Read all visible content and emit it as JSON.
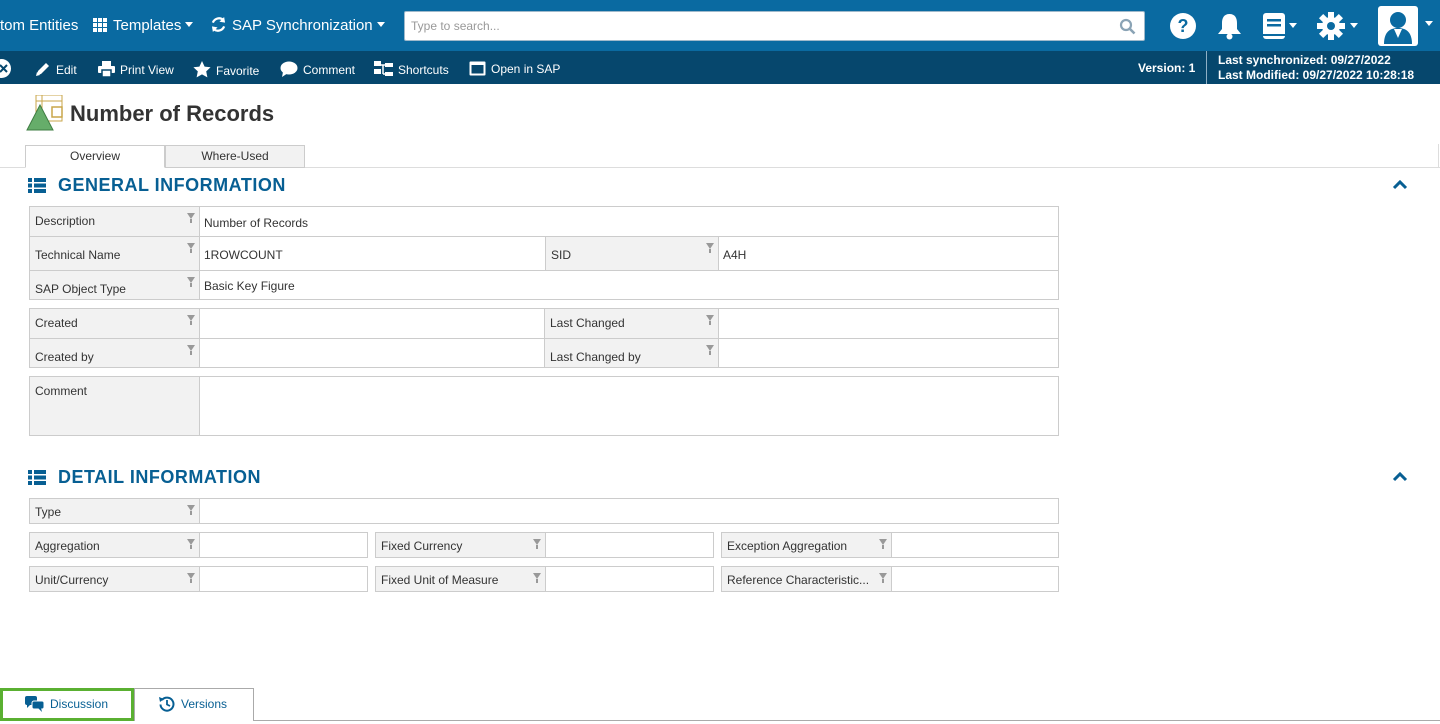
{
  "nav": {
    "custom_entities": "tom Entities",
    "templates": "Templates",
    "sap_sync": "SAP Synchronization",
    "search_placeholder": "Type to search..."
  },
  "toolbar": {
    "edit": "Edit",
    "print_view": "Print View",
    "favorite": "Favorite",
    "comment": "Comment",
    "shortcuts": "Shortcuts",
    "open_in_sap": "Open in SAP",
    "version": "Version: 1",
    "last_synchronized": "Last synchronized: 09/27/2022",
    "last_modified": "Last Modified: 09/27/2022 10:28:18"
  },
  "page": {
    "title": "Number of Records",
    "tabs": [
      "Overview",
      "Where-Used"
    ]
  },
  "general": {
    "title": "GENERAL INFORMATION",
    "description_label": "Description",
    "description_value": "Number of Records",
    "technical_name_label": "Technical Name",
    "technical_name_value": "1ROWCOUNT",
    "sid_label": "SID",
    "sid_value": "A4H",
    "sap_object_type_label": "SAP Object Type",
    "sap_object_type_value": "Basic Key Figure",
    "created_label": "Created",
    "last_changed_label": "Last Changed",
    "created_by_label": "Created by",
    "last_changed_by_label": "Last Changed by",
    "comment_label": "Comment"
  },
  "detail": {
    "title": "DETAIL INFORMATION",
    "type_label": "Type",
    "aggregation_label": "Aggregation",
    "fixed_currency_label": "Fixed Currency",
    "exception_aggregation_label": "Exception Aggregation",
    "unit_currency_label": "Unit/Currency",
    "fixed_uom_label": "Fixed Unit of Measure",
    "reference_char_label": "Reference Characteristic..."
  },
  "bottom": {
    "discussion": "Discussion",
    "versions": "Versions"
  },
  "colors": {
    "nav_bg": "#0a6aa1",
    "toolbar_bg": "#06476d",
    "section_title": "#075f93",
    "highlight": "#5ab031"
  }
}
